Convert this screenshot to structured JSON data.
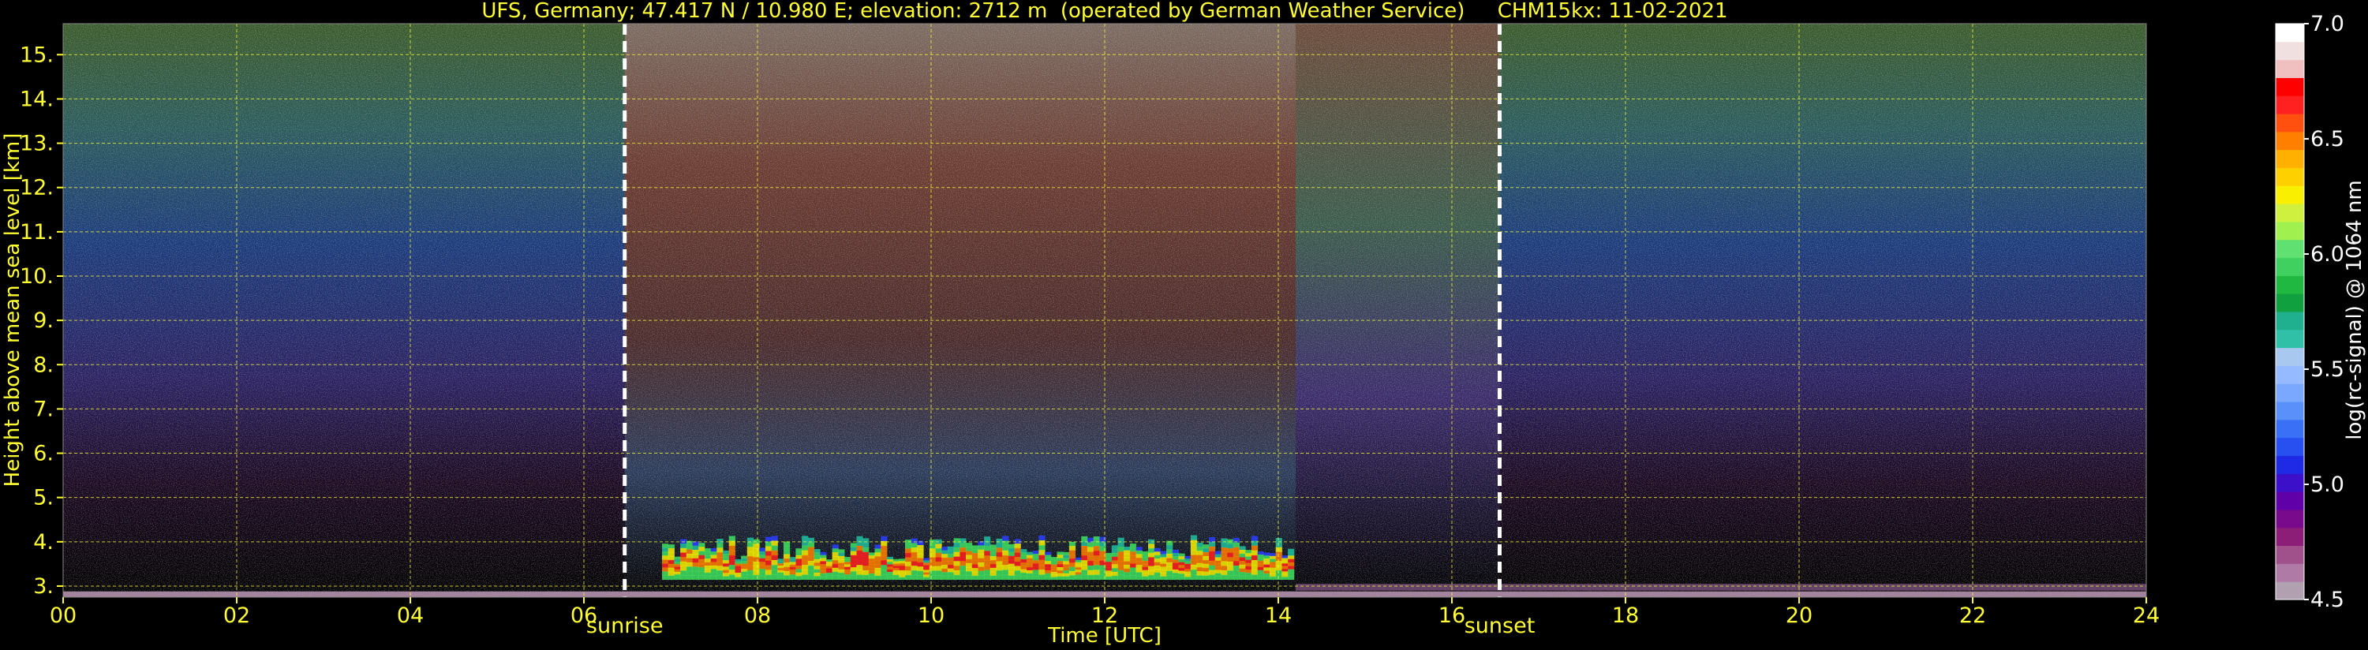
{
  "figure": {
    "title": "UFS, Germany; 47.417 N / 10.980 E; elevation: 2712 m  (operated by German Weather Service)     CHM15kx: 11-02-2021",
    "text_color": "#ffff33",
    "background": "#000000"
  },
  "chart_data": {
    "type": "heatmap",
    "title": "UFS, Germany; 47.417 N / 10.980 E; elevation: 2712 m  (operated by German Weather Service)     CHM15kx: 11-02-2021",
    "xlabel": "Time [UTC]",
    "ylabel": "Height above mean sea level [km]",
    "xlim": [
      0,
      24
    ],
    "ylim": [
      2.75,
      15.7
    ],
    "x_ticks": [
      "00",
      "02",
      "04",
      "06",
      "08",
      "10",
      "12",
      "14",
      "16",
      "18",
      "20",
      "22",
      "24"
    ],
    "x_tick_values": [
      0,
      2,
      4,
      6,
      8,
      10,
      12,
      14,
      16,
      18,
      20,
      22,
      24
    ],
    "y_ticks": [
      "3.",
      "4.",
      "5.",
      "6.",
      "7.",
      "8.",
      "9.",
      "10.",
      "11.",
      "12.",
      "13.",
      "14.",
      "15."
    ],
    "y_tick_values": [
      3,
      4,
      5,
      6,
      7,
      8,
      9,
      10,
      11,
      12,
      13,
      14,
      15
    ],
    "grid": true,
    "grid_color": "#ffff33",
    "markers": [
      {
        "label": "sunrise",
        "x": 6.47
      },
      {
        "label": "sunset",
        "x": 16.55
      }
    ],
    "colorbar": {
      "label": "log(rc-signal) @ 1064 nm",
      "range": [
        4.5,
        7.0
      ],
      "ticks": [
        "4.5",
        "5.0",
        "5.5",
        "6.0",
        "6.5",
        "7.0"
      ],
      "tick_values": [
        4.5,
        5.0,
        5.5,
        6.0,
        6.5,
        7.0
      ],
      "colors": [
        "#b0a0b0",
        "#b07aa6",
        "#a0508a",
        "#8c1e78",
        "#7a0a8c",
        "#6000a8",
        "#3c10c8",
        "#1e2ae6",
        "#2850f0",
        "#3a70f5",
        "#5a90fa",
        "#7aa8ff",
        "#96baff",
        "#a8c8f0",
        "#30c0a8",
        "#20b090",
        "#10a040",
        "#20b840",
        "#40d060",
        "#60e070",
        "#a0f050",
        "#d0f040",
        "#f8f000",
        "#ffd000",
        "#ffb000",
        "#ff8000",
        "#ff5010",
        "#ff2020",
        "#ff0000",
        "#f0c0c0",
        "#f0e0e0",
        "#ffffff"
      ]
    }
  }
}
